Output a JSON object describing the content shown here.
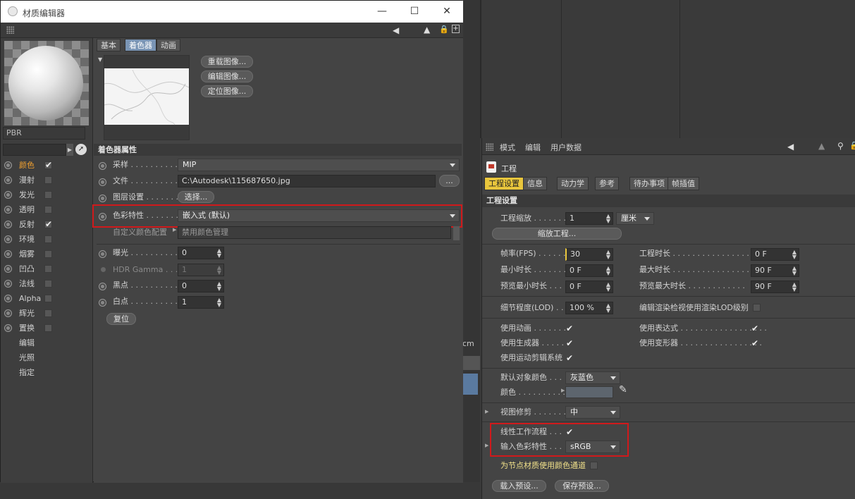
{
  "material_editor": {
    "window_title": "材质编辑器",
    "material_name": "PBR",
    "channels": [
      {
        "label": "颜色",
        "checked": true,
        "active": true,
        "radio": true
      },
      {
        "label": "漫射",
        "checked": false,
        "radio": true
      },
      {
        "label": "发光",
        "checked": false,
        "radio": true
      },
      {
        "label": "透明",
        "checked": false,
        "radio": true
      },
      {
        "label": "反射",
        "checked": true,
        "radio": true
      },
      {
        "label": "环境",
        "checked": false,
        "radio": true
      },
      {
        "label": "烟雾",
        "checked": false,
        "radio": true
      },
      {
        "label": "凹凸",
        "checked": false,
        "radio": true
      },
      {
        "label": "法线",
        "checked": false,
        "radio": true
      },
      {
        "label": "Alpha",
        "checked": false,
        "radio": true
      },
      {
        "label": "辉光",
        "checked": false,
        "radio": true
      },
      {
        "label": "置换",
        "checked": false,
        "radio": true
      },
      {
        "label": "编辑",
        "radio": false
      },
      {
        "label": "光照",
        "radio": false
      },
      {
        "label": "指定",
        "radio": false
      }
    ],
    "tabs": [
      "基本",
      "着色器",
      "动画"
    ],
    "image_buttons": [
      "重载图像...",
      "编辑图像...",
      "定位图像..."
    ],
    "shader_section": "着色器属性",
    "sampling_label": "采样",
    "sampling_value": "MIP",
    "file_label": "文件",
    "file_value": "C:\\Autodesk\\115687650.jpg",
    "file_browse": "...",
    "layer_label": "图层设置",
    "layer_button": "选择...",
    "color_profile_label": "色彩特性",
    "color_profile_value": "嵌入式 (默认)",
    "custom_profile_label": "自定义颜色配置",
    "custom_profile_value": "禁用颜色管理",
    "exposure_label": "曝光",
    "exposure_value": "0",
    "hdr_label": "HDR Gamma",
    "hdr_value": "1",
    "black_label": "黑点",
    "black_value": "0",
    "white_label": "白点",
    "white_value": "1",
    "reset_button": "复位"
  },
  "attributes": {
    "menu": [
      "模式",
      "编辑",
      "用户数据"
    ],
    "object_title": "工程",
    "tabs": [
      "工程设置",
      "信息",
      "动力学",
      "参考",
      "待办事项",
      "帧插值"
    ],
    "section": "工程设置",
    "scale_label": "工程缩放",
    "scale_value": "1",
    "scale_unit": "厘米",
    "scale_button": "缩放工程...",
    "fps_label": "帧率(FPS)",
    "fps_value": "30",
    "time_label": "工程时长",
    "time_value": "0 F",
    "min_time_label": "最小时长",
    "min_time_value": "0 F",
    "max_time_label": "最大时长",
    "max_time_value": "90 F",
    "prev_min_label": "预览最小时长",
    "prev_min_value": "0 F",
    "prev_max_label": "预览最大时长",
    "prev_max_value": "90 F",
    "lod_label": "细节程度(LOD)",
    "lod_value": "100 %",
    "lod_render_label": "编辑渲染检视使用渲染LOD级别",
    "use_anim_label": "使用动画",
    "use_expr_label": "使用表达式",
    "use_gen_label": "使用生成器",
    "use_deform_label": "使用变形器",
    "use_motion_label": "使用运动剪辑系统",
    "default_color_label": "默认对象颜色",
    "default_color_value": "灰蓝色",
    "color_label": "颜色",
    "view_clip_label": "视图修剪",
    "view_clip_value": "中",
    "linear_label": "线性工作流程",
    "input_profile_label": "输入色彩特性",
    "input_profile_value": "sRGB",
    "node_label": "为节点材质使用颜色通道",
    "load_preset": "载入预设...",
    "save_preset": "保存预设..."
  },
  "background": {
    "unit_hint": "cm"
  },
  "colors": {
    "active_channel": "#f0a030",
    "active_tab": "#7a95b5",
    "active_attr_tab": "#e9c63c",
    "highlight": "#d0191b"
  }
}
